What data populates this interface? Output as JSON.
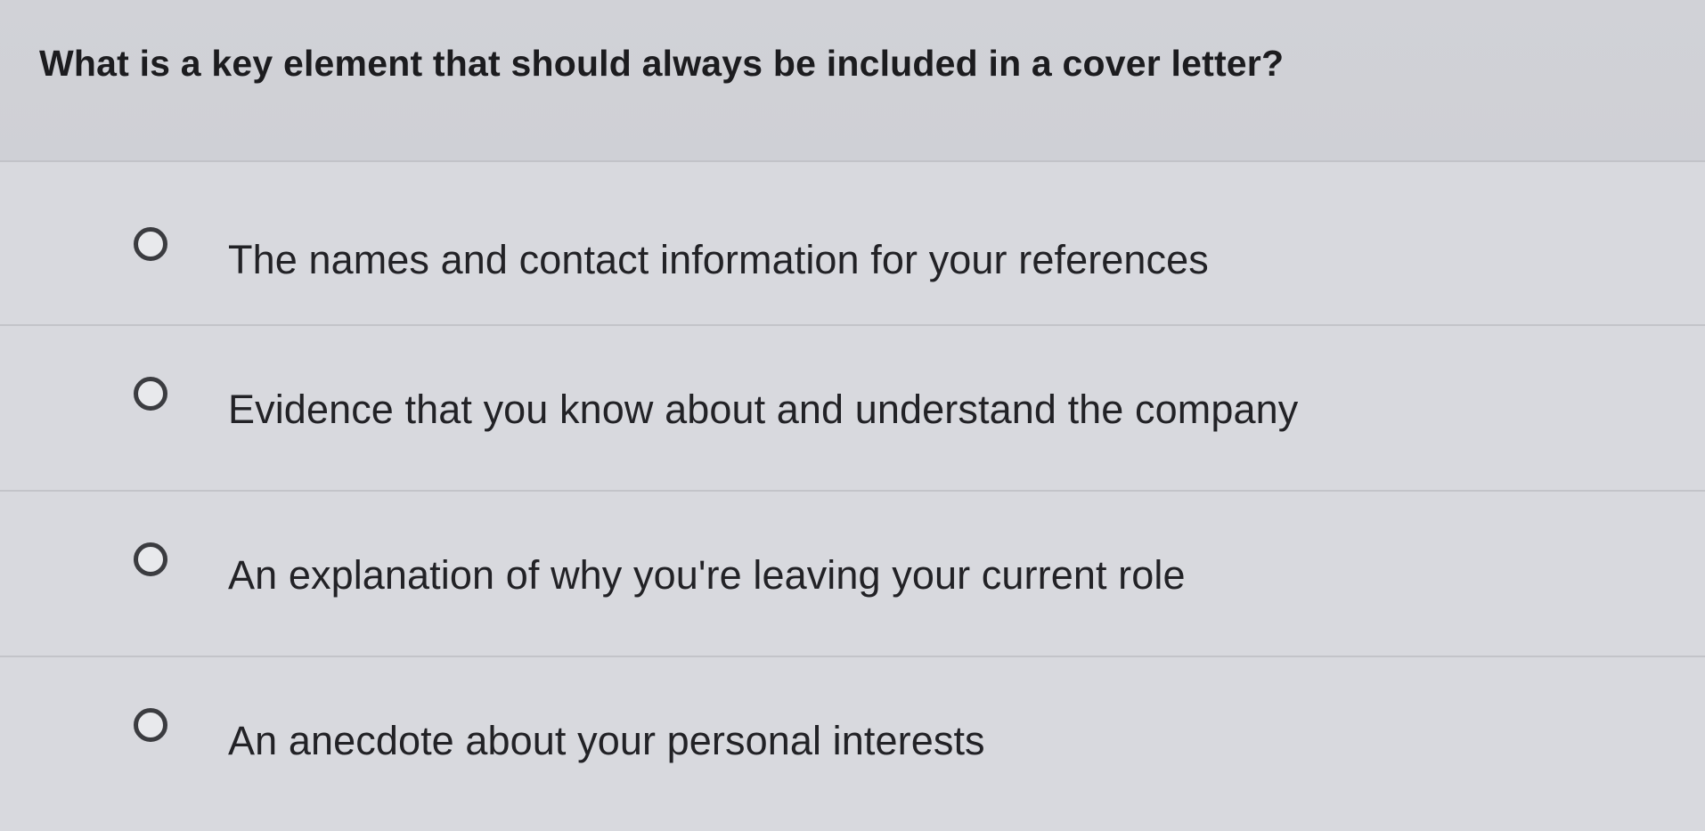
{
  "question": {
    "text": "What is a key element that should always be included in a cover letter?"
  },
  "options": [
    {
      "label": "The names and contact information for your references",
      "selected": false
    },
    {
      "label": "Evidence that you know about and understand the company",
      "selected": false
    },
    {
      "label": "An explanation of why you're leaving your current role",
      "selected": false
    },
    {
      "label": "An anecdote about your personal interests",
      "selected": false
    }
  ],
  "icons": {
    "radio": "radio-unselected-icon"
  },
  "colors": {
    "background": "#d6d7dc",
    "radio_border": "#3b3c40",
    "text": "#1f1f22"
  }
}
